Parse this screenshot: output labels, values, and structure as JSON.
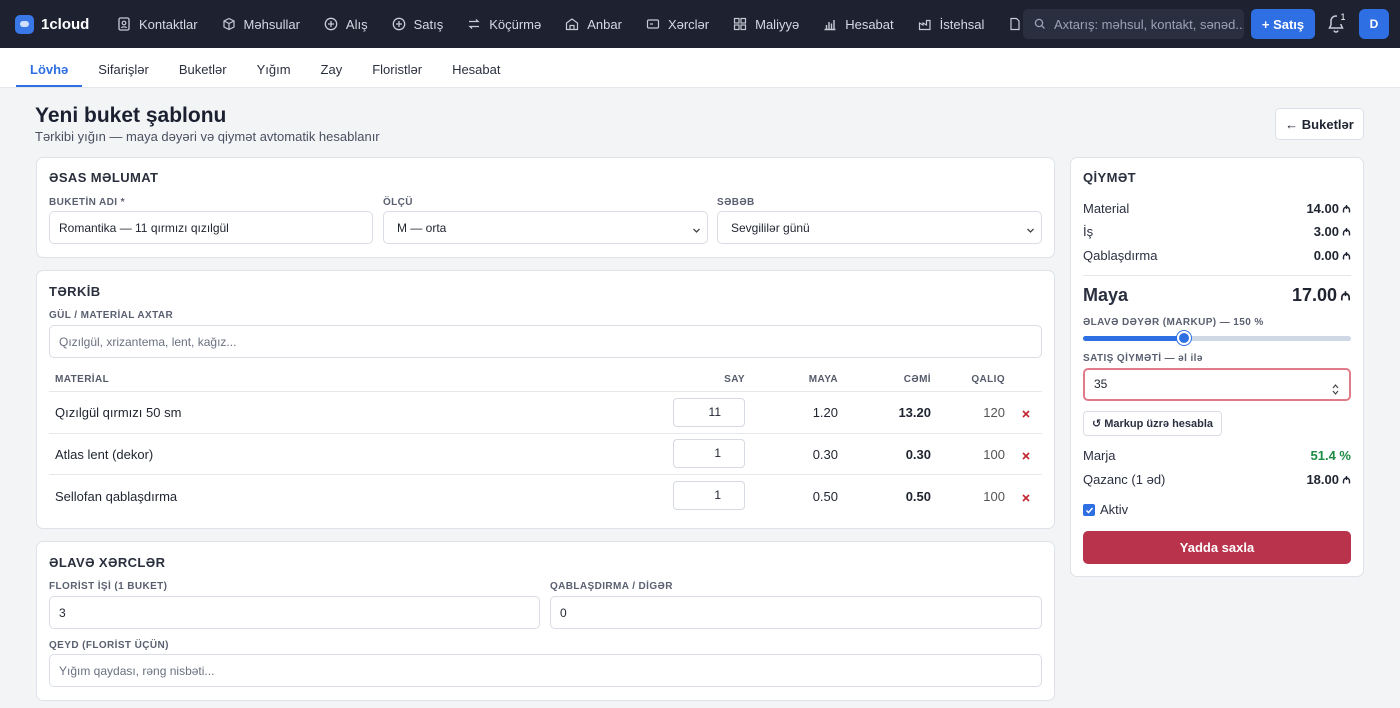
{
  "app": {
    "name": "1cloud"
  },
  "nav": {
    "items": [
      {
        "label": "Kontaktlar",
        "icon": "contacts-icon"
      },
      {
        "label": "Məhsullar",
        "icon": "box-icon"
      },
      {
        "label": "Alış",
        "icon": "plus-circle-icon"
      },
      {
        "label": "Satış",
        "icon": "plus-circle-icon"
      },
      {
        "label": "Köçürmə",
        "icon": "transfer-icon"
      },
      {
        "label": "Anbar",
        "icon": "warehouse-icon"
      },
      {
        "label": "Xərclər",
        "icon": "wallet-icon"
      },
      {
        "label": "Maliyyə",
        "icon": "grid-icon"
      },
      {
        "label": "Hesabat",
        "icon": "bar-chart-icon"
      },
      {
        "label": "İstehsal",
        "icon": "factory-icon"
      }
    ],
    "search_placeholder": "Axtarış: məhsul, kontakt, sənəd...",
    "sale_button": "+ Satış",
    "notification_count": "1",
    "avatar_initial": "D"
  },
  "subnav": {
    "tabs": [
      "Lövhə",
      "Sifarişlər",
      "Buketlər",
      "Yığım",
      "Zay",
      "Floristlər",
      "Hesabat"
    ],
    "active_index": 0
  },
  "header": {
    "title": "Yeni buket şablonu",
    "subtitle": "Tərkibi yığın — maya dəyəri və qiymət avtomatik hesablanır",
    "back_button": "← Buketlər"
  },
  "basic_info": {
    "title": "ƏSAS MƏLUMAT",
    "name_label": "BUKETİN ADI *",
    "name_value": "Romantika — 11 qırmızı qızılgül",
    "size_label": "ÖLÇÜ",
    "size_value": "M — orta",
    "reason_label": "SƏBƏB",
    "reason_value": "Sevgililər günü"
  },
  "composition": {
    "title": "TƏRKİB",
    "search_label": "GÜL / MATERİAL AXTAR",
    "search_placeholder": "Qızılgül, xrizantema, lent, kağız...",
    "columns": {
      "material": "MATERİAL",
      "qty": "SAY",
      "cost": "MAYA",
      "total": "CƏMİ",
      "stock": "QALIQ"
    },
    "rows": [
      {
        "material": "Qızılgül qırmızı 50 sm",
        "qty": "11",
        "cost": "1.20",
        "total": "13.20",
        "stock": "120"
      },
      {
        "material": "Atlas lent (dekor)",
        "qty": "1",
        "cost": "0.30",
        "total": "0.30",
        "stock": "100"
      },
      {
        "material": "Sellofan qablaşdırma",
        "qty": "1",
        "cost": "0.50",
        "total": "0.50",
        "stock": "100"
      }
    ]
  },
  "extra_costs": {
    "title": "ƏLAVƏ XƏRCLƏR",
    "florist_label": "FLORİST İŞİ (1 BUKET)",
    "florist_value": "3",
    "packaging_label": "QABLAŞDIRMA / DİGƏR",
    "packaging_value": "0",
    "note_label": "QEYD (FLORİST ÜÇÜN)",
    "note_placeholder": "Yığım qaydası, rəng nisbəti..."
  },
  "pricing": {
    "title": "QİYMƏT",
    "material_label": "Material",
    "material_value": "14.00",
    "labor_label": "İş",
    "labor_value": "3.00",
    "packaging_label": "Qablaşdırma",
    "packaging_value": "0.00",
    "cost_label": "Maya",
    "cost_value": "17.00",
    "markup_label": "ƏLAVƏ DƏYƏR (MARKUP) — 150 %",
    "markup_percent": 150,
    "markup_max": 400,
    "sale_label": "SATIŞ QİYMƏTİ — əl ilə",
    "sale_value": "35",
    "markup_button": "↺ Markup üzrə hesabla",
    "margin_label": "Marja",
    "margin_value": "51.4 %",
    "profit_label": "Qazanc (1 əd)",
    "profit_value": "18.00",
    "active_label": "Aktiv",
    "save_button": "Yadda saxla"
  }
}
